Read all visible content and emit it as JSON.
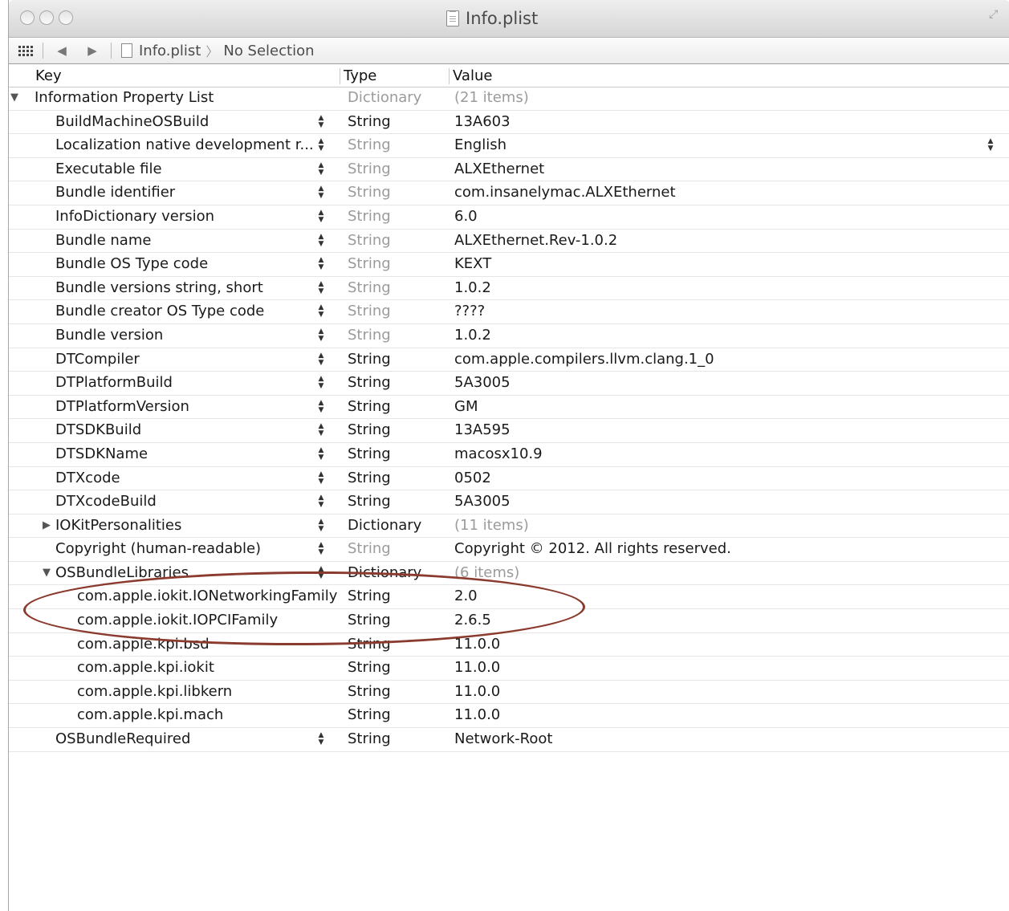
{
  "window": {
    "title": "Info.plist"
  },
  "jumpbar": {
    "file": "Info.plist",
    "selection": "No Selection"
  },
  "columns": {
    "key": "Key",
    "type": "Type",
    "value": "Value"
  },
  "rows": [
    {
      "key": "Information Property List",
      "type": "Dictionary",
      "value": "(21 items)",
      "level": 0,
      "disclosure": "open",
      "type_dim": true,
      "value_dim": true,
      "stepper": false
    },
    {
      "key": "BuildMachineOSBuild",
      "type": "String",
      "value": "13A603",
      "level": 1,
      "type_dim": false,
      "stepper": true
    },
    {
      "key": "Localization native development r...",
      "type": "String",
      "value": "English",
      "level": 1,
      "type_dim": true,
      "stepper": true,
      "value_stepper": true
    },
    {
      "key": "Executable file",
      "type": "String",
      "value": "ALXEthernet",
      "level": 1,
      "type_dim": true,
      "stepper": true
    },
    {
      "key": "Bundle identifier",
      "type": "String",
      "value": "com.insanelymac.ALXEthernet",
      "level": 1,
      "type_dim": true,
      "stepper": true
    },
    {
      "key": "InfoDictionary version",
      "type": "String",
      "value": "6.0",
      "level": 1,
      "type_dim": true,
      "stepper": true
    },
    {
      "key": "Bundle name",
      "type": "String",
      "value": "ALXEthernet.Rev-1.0.2",
      "level": 1,
      "type_dim": true,
      "stepper": true
    },
    {
      "key": "Bundle OS Type code",
      "type": "String",
      "value": "KEXT",
      "level": 1,
      "type_dim": true,
      "stepper": true
    },
    {
      "key": "Bundle versions string, short",
      "type": "String",
      "value": "1.0.2",
      "level": 1,
      "type_dim": true,
      "stepper": true
    },
    {
      "key": "Bundle creator OS Type code",
      "type": "String",
      "value": "????",
      "level": 1,
      "type_dim": true,
      "stepper": true
    },
    {
      "key": "Bundle version",
      "type": "String",
      "value": "1.0.2",
      "level": 1,
      "type_dim": true,
      "stepper": true
    },
    {
      "key": "DTCompiler",
      "type": "String",
      "value": "com.apple.compilers.llvm.clang.1_0",
      "level": 1,
      "type_dim": false,
      "stepper": true
    },
    {
      "key": "DTPlatformBuild",
      "type": "String",
      "value": "5A3005",
      "level": 1,
      "type_dim": false,
      "stepper": true
    },
    {
      "key": "DTPlatformVersion",
      "type": "String",
      "value": "GM",
      "level": 1,
      "type_dim": false,
      "stepper": true
    },
    {
      "key": "DTSDKBuild",
      "type": "String",
      "value": "13A595",
      "level": 1,
      "type_dim": false,
      "stepper": true
    },
    {
      "key": "DTSDKName",
      "type": "String",
      "value": "macosx10.9",
      "level": 1,
      "type_dim": false,
      "stepper": true
    },
    {
      "key": "DTXcode",
      "type": "String",
      "value": "0502",
      "level": 1,
      "type_dim": false,
      "stepper": true
    },
    {
      "key": "DTXcodeBuild",
      "type": "String",
      "value": "5A3005",
      "level": 1,
      "type_dim": false,
      "stepper": true
    },
    {
      "key": "IOKitPersonalities",
      "type": "Dictionary",
      "value": "(11 items)",
      "level": 1,
      "disclosure": "closed",
      "type_dim": false,
      "value_dim": true,
      "stepper": true
    },
    {
      "key": "Copyright (human-readable)",
      "type": "String",
      "value": "Copyright © 2012. All rights reserved.",
      "level": 1,
      "type_dim": true,
      "stepper": true
    },
    {
      "key": "OSBundleLibraries",
      "type": "Dictionary",
      "value": "(6 items)",
      "level": 1,
      "disclosure": "open",
      "type_dim": false,
      "value_dim": true,
      "stepper": true
    },
    {
      "key": "com.apple.iokit.IONetworkingFamily",
      "type": "String",
      "value": "2.0",
      "level": 2,
      "type_dim": false,
      "stepper": false
    },
    {
      "key": "com.apple.iokit.IOPCIFamily",
      "type": "String",
      "value": "2.6.5",
      "level": 2,
      "type_dim": false,
      "stepper": false
    },
    {
      "key": "com.apple.kpi.bsd",
      "type": "String",
      "value": "11.0.0",
      "level": 2,
      "type_dim": false,
      "stepper": false
    },
    {
      "key": "com.apple.kpi.iokit",
      "type": "String",
      "value": "11.0.0",
      "level": 2,
      "type_dim": false,
      "stepper": false
    },
    {
      "key": "com.apple.kpi.libkern",
      "type": "String",
      "value": "11.0.0",
      "level": 2,
      "type_dim": false,
      "stepper": false
    },
    {
      "key": "com.apple.kpi.mach",
      "type": "String",
      "value": "11.0.0",
      "level": 2,
      "type_dim": false,
      "stepper": false
    },
    {
      "key": "OSBundleRequired",
      "type": "String",
      "value": "Network-Root",
      "level": 1,
      "type_dim": false,
      "stepper": true
    }
  ],
  "colors": {
    "annotation": "#8b3a2e",
    "dim_text": "#9b9b9b"
  }
}
